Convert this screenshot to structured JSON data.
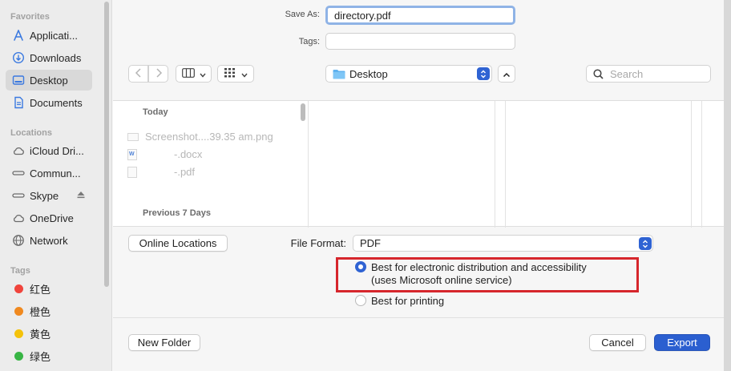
{
  "sidebar": {
    "favorites_heading": "Favorites",
    "favorites": [
      {
        "label": "Applicati...",
        "icon": "applications-icon"
      },
      {
        "label": "Downloads",
        "icon": "downloads-icon"
      },
      {
        "label": "Desktop",
        "icon": "desktop-icon",
        "selected": true
      },
      {
        "label": "Documents",
        "icon": "documents-icon"
      }
    ],
    "locations_heading": "Locations",
    "locations": [
      {
        "label": "iCloud Dri...",
        "icon": "cloud-icon"
      },
      {
        "label": "Commun...",
        "icon": "drive-icon"
      },
      {
        "label": "Skype",
        "icon": "drive-icon"
      },
      {
        "label": "OneDrive",
        "icon": "cloud-icon"
      },
      {
        "label": "Network",
        "icon": "network-icon"
      }
    ],
    "tags_heading": "Tags",
    "tags": [
      {
        "label": "红色",
        "color": "#f0443c"
      },
      {
        "label": "橙色",
        "color": "#f0891f"
      },
      {
        "label": "黄色",
        "color": "#f4c20a"
      },
      {
        "label": "绿色",
        "color": "#38b545"
      }
    ]
  },
  "save_as": {
    "label": "Save As:",
    "value": "directory.pdf"
  },
  "tags_field": {
    "label": "Tags:",
    "value": ""
  },
  "location_popup": "Desktop",
  "search": {
    "placeholder": "Search"
  },
  "browser": {
    "today_heading": "Today",
    "today_files": [
      "Screenshot....39.35 am.png",
      "-.docx",
      "-.pdf"
    ],
    "previous_heading": "Previous 7 Days"
  },
  "online_locations_button": "Online Locations",
  "file_format": {
    "label": "File Format:",
    "value": "PDF"
  },
  "options": [
    {
      "line1": "Best for electronic distribution and accessibility",
      "line2": "(uses Microsoft online service)",
      "selected": true
    },
    {
      "line1": "Best for printing",
      "line2": "",
      "selected": false
    }
  ],
  "buttons": {
    "new_folder": "New Folder",
    "cancel": "Cancel",
    "export": "Export"
  },
  "colors": {
    "accent": "#2b5fd0",
    "highlight": "#d6262c"
  }
}
